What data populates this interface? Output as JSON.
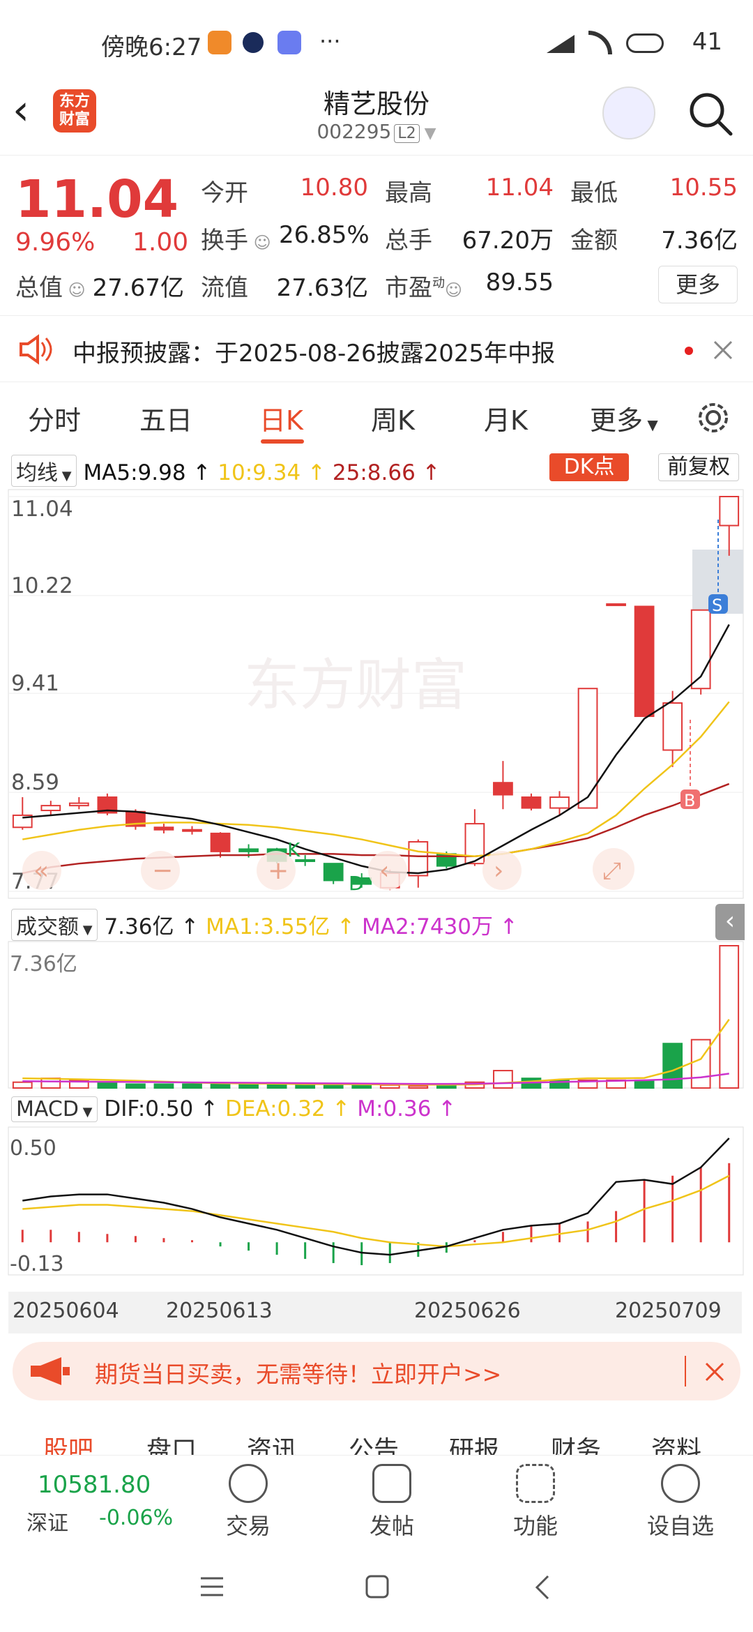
{
  "status": {
    "time": "傍晚6:27",
    "battery": "41",
    "more": "···"
  },
  "header": {
    "title": "精艺股份",
    "code": "002295",
    "level": "L2",
    "logo": "东方\n财富"
  },
  "quote": {
    "price": "11.04",
    "pct": "9.96%",
    "change": "1.00",
    "open_label": "今开",
    "open": "10.80",
    "high_label": "最高",
    "high": "11.04",
    "low_label": "最低",
    "low": "10.55",
    "turnover_label": "换手",
    "turnover": "26.85%",
    "volume_label": "总手",
    "volume": "67.20万",
    "amount_label": "金额",
    "amount": "7.36亿",
    "mcap_label": "总值",
    "mcap": "27.67亿",
    "float_label": "流值",
    "float": "27.63亿",
    "pe_label": "市盈",
    "pe_sup": "动",
    "pe": "89.55",
    "more": "更多"
  },
  "notice": {
    "text": "中报预披露：于2025-08-26披露2025年中报"
  },
  "tabs": [
    "分时",
    "五日",
    "日K",
    "周K",
    "月K",
    "更多"
  ],
  "active_tab": 2,
  "kline": {
    "ma_selector": "均线",
    "ma5": "MA5:9.98",
    "ma10": "10:9.34",
    "ma25": "25:8.66",
    "dk_button": "DK点",
    "adjust": "前复权",
    "y_labels": [
      "11.04",
      "10.22",
      "9.41",
      "8.59",
      "7.77"
    ],
    "watermark": "东方财富",
    "marker_s": "S",
    "marker_b": "B",
    "marker_k": "K",
    "marker_d": "D"
  },
  "volume": {
    "selector": "成交额",
    "value": "7.36亿",
    "ma1": "MA1:3.55亿",
    "ma2": "MA2:7430万",
    "y_label": "7.36亿"
  },
  "macd": {
    "selector": "MACD",
    "dif": "DIF:0.50",
    "dea": "DEA:0.32",
    "m": "M:0.36",
    "y_top": "0.50",
    "y_bottom": "-0.13"
  },
  "dates": [
    "20250604",
    "20250613",
    "20250626",
    "20250709"
  ],
  "ad": {
    "text": "期货当日买卖，无需等待！立即开户>>"
  },
  "subtabs": [
    "股吧",
    "盘口",
    "资讯",
    "公告",
    "研报",
    "财务",
    "资料"
  ],
  "bottom": {
    "index_value": "10581.80",
    "index_name": "深证",
    "index_pct": "-0.06%",
    "trade": "交易",
    "post": "发帖",
    "func": "功能",
    "watch": "设自选"
  },
  "colors": {
    "up": "#e03a3a",
    "down": "#1aa34a",
    "accent": "#e94b2a",
    "ma5": "#111111",
    "ma10": "#f0c419",
    "ma25": "#b22222",
    "ma2": "#cc33cc"
  },
  "chart_data": {
    "type": "candlestick",
    "candles": [
      {
        "o": 8.3,
        "c": 8.4,
        "h": 8.55,
        "l": 8.28,
        "up": true
      },
      {
        "o": 8.44,
        "c": 8.48,
        "h": 8.52,
        "l": 8.4,
        "up": true
      },
      {
        "o": 8.48,
        "c": 8.5,
        "h": 8.55,
        "l": 8.45,
        "up": true
      },
      {
        "o": 8.55,
        "c": 8.42,
        "h": 8.58,
        "l": 8.4,
        "up": false
      },
      {
        "o": 8.43,
        "c": 8.31,
        "h": 8.45,
        "l": 8.28,
        "up": false
      },
      {
        "o": 8.3,
        "c": 8.28,
        "h": 8.33,
        "l": 8.25,
        "up": false
      },
      {
        "o": 8.28,
        "c": 8.27,
        "h": 8.31,
        "l": 8.24,
        "up": false
      },
      {
        "o": 8.25,
        "c": 8.1,
        "h": 8.26,
        "l": 8.05,
        "up": false
      },
      {
        "o": 8.12,
        "c": 8.1,
        "h": 8.16,
        "l": 8.05,
        "up": false
      },
      {
        "o": 8.12,
        "c": 8.02,
        "h": 8.13,
        "l": 8.0,
        "up": false
      },
      {
        "o": 8.03,
        "c": 8.02,
        "h": 8.07,
        "l": 7.98,
        "up": false
      },
      {
        "o": 8.0,
        "c": 7.86,
        "h": 8.0,
        "l": 7.83,
        "up": false
      },
      {
        "o": 7.88,
        "c": 7.83,
        "h": 7.92,
        "l": 7.8,
        "up": false
      },
      {
        "o": 7.8,
        "c": 7.92,
        "h": 7.95,
        "l": 7.78,
        "up": true
      },
      {
        "o": 7.9,
        "c": 8.18,
        "h": 8.2,
        "l": 7.8,
        "up": true
      },
      {
        "o": 8.08,
        "c": 7.98,
        "h": 8.1,
        "l": 7.96,
        "up": false
      },
      {
        "o": 8.0,
        "c": 8.33,
        "h": 8.45,
        "l": 7.98,
        "up": true
      },
      {
        "o": 8.67,
        "c": 8.57,
        "h": 8.85,
        "l": 8.45,
        "up": false
      },
      {
        "o": 8.55,
        "c": 8.46,
        "h": 8.58,
        "l": 8.44,
        "up": false
      },
      {
        "o": 8.46,
        "c": 8.55,
        "h": 8.6,
        "l": 8.4,
        "up": true
      },
      {
        "o": 8.46,
        "c": 9.45,
        "h": 9.45,
        "l": 8.46,
        "up": true
      },
      {
        "o": 10.15,
        "c": 10.15,
        "h": 10.15,
        "l": 10.15,
        "up": false
      },
      {
        "o": 10.13,
        "c": 9.22,
        "h": 10.13,
        "l": 9.22,
        "up": false
      },
      {
        "o": 8.94,
        "c": 9.33,
        "h": 9.43,
        "l": 8.8,
        "up": true
      },
      {
        "o": 9.45,
        "c": 10.1,
        "h": 10.1,
        "l": 9.4,
        "up": true
      },
      {
        "o": 10.8,
        "c": 11.04,
        "h": 11.04,
        "l": 10.55,
        "up": true
      }
    ],
    "ma5": [
      8.38,
      8.4,
      8.42,
      8.44,
      8.43,
      8.4,
      8.37,
      8.32,
      8.26,
      8.2,
      8.12,
      8.05,
      7.98,
      7.93,
      7.92,
      7.95,
      8.02,
      8.15,
      8.28,
      8.4,
      8.55,
      8.9,
      9.2,
      9.35,
      9.55,
      9.98
    ],
    "ma10": [
      8.2,
      8.24,
      8.28,
      8.31,
      8.33,
      8.34,
      8.34,
      8.33,
      8.32,
      8.3,
      8.27,
      8.24,
      8.2,
      8.15,
      8.1,
      8.08,
      8.06,
      8.08,
      8.12,
      8.18,
      8.25,
      8.4,
      8.62,
      8.82,
      9.05,
      9.34
    ],
    "ma25": [
      7.92,
      7.97,
      8.0,
      8.02,
      8.04,
      8.05,
      8.06,
      8.07,
      8.07,
      8.08,
      8.08,
      8.08,
      8.07,
      8.07,
      8.06,
      8.06,
      8.06,
      8.08,
      8.12,
      8.16,
      8.21,
      8.3,
      8.4,
      8.48,
      8.57,
      8.66
    ],
    "volume": [
      0.3,
      0.5,
      0.4,
      0.25,
      0.2,
      0.2,
      0.2,
      0.2,
      0.2,
      0.2,
      0.15,
      0.15,
      0.15,
      0.15,
      0.1,
      0.2,
      0.3,
      0.9,
      0.5,
      0.4,
      0.4,
      0.4,
      0.4,
      2.3,
      2.5,
      7.36
    ],
    "volume_up": [
      true,
      true,
      true,
      false,
      false,
      false,
      false,
      false,
      false,
      false,
      false,
      false,
      false,
      true,
      true,
      false,
      true,
      true,
      false,
      false,
      true,
      true,
      false,
      false,
      true,
      true
    ],
    "vol_ma1": [
      0.5,
      0.48,
      0.45,
      0.42,
      0.38,
      0.33,
      0.28,
      0.25,
      0.23,
      0.22,
      0.2,
      0.2,
      0.19,
      0.18,
      0.17,
      0.17,
      0.18,
      0.26,
      0.34,
      0.44,
      0.5,
      0.5,
      0.52,
      0.9,
      1.5,
      3.55
    ],
    "vol_ma2": [
      0.35,
      0.34,
      0.33,
      0.32,
      0.31,
      0.3,
      0.29,
      0.28,
      0.27,
      0.26,
      0.25,
      0.24,
      0.23,
      0.22,
      0.21,
      0.21,
      0.22,
      0.25,
      0.28,
      0.31,
      0.34,
      0.37,
      0.4,
      0.45,
      0.55,
      0.743
    ],
    "macd_hist": [
      0.06,
      0.06,
      0.05,
      0.04,
      0.03,
      0.02,
      0.01,
      -0.02,
      -0.04,
      -0.06,
      -0.08,
      -0.1,
      -0.11,
      -0.1,
      -0.07,
      -0.05,
      0.01,
      0.05,
      0.08,
      0.09,
      0.1,
      0.15,
      0.3,
      0.32,
      0.36,
      0.38
    ],
    "dif": [
      0.2,
      0.22,
      0.23,
      0.23,
      0.21,
      0.19,
      0.16,
      0.12,
      0.09,
      0.06,
      0.02,
      -0.02,
      -0.05,
      -0.06,
      -0.04,
      -0.02,
      0.02,
      0.06,
      0.08,
      0.09,
      0.14,
      0.29,
      0.3,
      0.28,
      0.36,
      0.5
    ],
    "dea": [
      0.16,
      0.17,
      0.18,
      0.18,
      0.17,
      0.16,
      0.15,
      0.13,
      0.11,
      0.09,
      0.07,
      0.05,
      0.02,
      0.0,
      -0.01,
      -0.02,
      -0.01,
      0.0,
      0.02,
      0.04,
      0.06,
      0.1,
      0.16,
      0.2,
      0.25,
      0.32
    ],
    "price_range": [
      7.77,
      11.04
    ],
    "macd_range": [
      -0.13,
      0.5
    ]
  }
}
